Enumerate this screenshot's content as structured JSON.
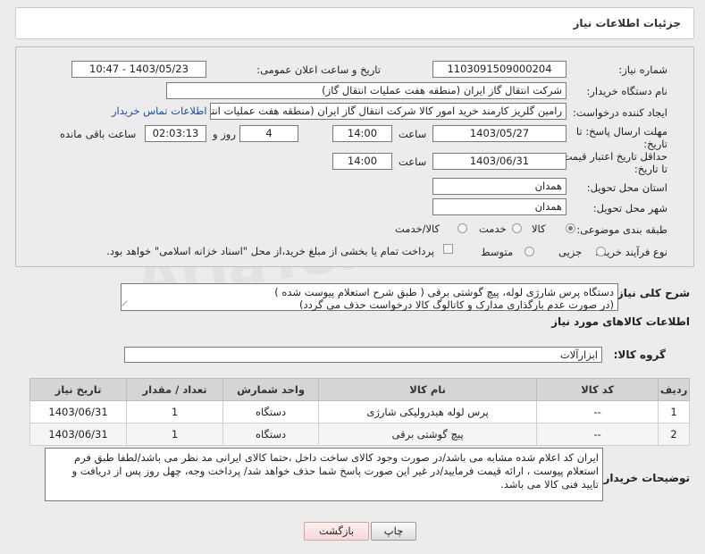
{
  "panel": {
    "title": "جزئیات اطلاعات نیاز"
  },
  "form": {
    "need_number": {
      "label": "شماره نیاز:",
      "value": "1103091509000204"
    },
    "announce_datetime": {
      "label": "تاریخ و ساعت اعلان عمومی:",
      "value": "1403/05/23 - 10:47"
    },
    "buyer_org": {
      "label": "نام دستگاه خریدار:",
      "value": "شرکت انتقال گاز ایران (منطقه هفت عملیات انتقال گاز)"
    },
    "requester": {
      "label": "ایجاد کننده درخواست:",
      "value": "رامین گلریز کارمند خرید امور کالا شرکت انتقال گاز ایران (منطقه هفت عملیات انتق",
      "contact_link": "اطلاعات تماس خریدار"
    },
    "deadline": {
      "label": "مهلت ارسال پاسخ: تا تاریخ:",
      "date": "1403/05/27",
      "time_label": "ساعت",
      "time": "14:00",
      "days": "4",
      "days_label": "روز و",
      "remaining": "02:03:13",
      "remaining_label": "ساعت باقی مانده"
    },
    "price_validity": {
      "label": "حداقل تاریخ اعتبار قیمت: تا تاریخ:",
      "date": "1403/06/31",
      "time_label": "ساعت",
      "time": "14:00"
    },
    "province": {
      "label": "استان محل تحویل:",
      "value": "همدان"
    },
    "city": {
      "label": "شهر محل تحویل:",
      "value": "همدان"
    },
    "category": {
      "label": "طبقه بندی موضوعی:",
      "options": [
        "کالا",
        "خدمت",
        "کالا/خدمت"
      ],
      "selected": "کالا"
    },
    "purchase_type": {
      "label": "نوع فرآیند خرید :",
      "options": [
        "جزیی",
        "متوسط"
      ],
      "payment_note": "پرداخت تمام یا بخشی از مبلغ خرید،از محل \"اسناد خزانه اسلامی\" خواهد بود."
    }
  },
  "description": {
    "label": "شرح کلی نیاز:",
    "line1": "دستگاه پرس شارژی لوله، پیچ گوشتی برقی ( طبق شرح استعلام پیوست شده )",
    "line2": "(در صورت عدم بارگذاری مدارک و کاتالوگ کالا درخواست حذف می گردد)"
  },
  "goods_info": {
    "title": "اطلاعات کالاهای مورد نیاز"
  },
  "goods_group": {
    "label": "گروه کالا:",
    "value": "ابزارآلات"
  },
  "table": {
    "headers": [
      "ردیف",
      "کد کالا",
      "نام کالا",
      "واحد شمارش",
      "تعداد / مقدار",
      "تاریخ نیاز"
    ],
    "rows": [
      {
        "idx": "1",
        "code": "--",
        "name": "پرس لوله هیدرولیکی شارژی",
        "unit": "دستگاه",
        "qty": "1",
        "date": "1403/06/31"
      },
      {
        "idx": "2",
        "code": "--",
        "name": "پیچ گوشتی برقی",
        "unit": "دستگاه",
        "qty": "1",
        "date": "1403/06/31"
      }
    ]
  },
  "buyer_notes": {
    "label": "توضیحات خریدار:",
    "line1": "ایران کد اعلام شده مشابه می باشد/در صورت وجود کالای ساخت داخل ،حتما کالای ایرانی مد نظر می باشد/لطفا طبق فرم",
    "line2": "استعلام پیوست ، ارائه قیمت فرمایید/در غیر این صورت پاسخ شما حذف خواهد شد/ پرداخت وجه، چهل روز پس از دریافت و",
    "line3": "تایید فنی کالا می باشد."
  },
  "buttons": {
    "print": "چاپ",
    "back": "بازگشت"
  },
  "watermark": "AriaTender.net"
}
